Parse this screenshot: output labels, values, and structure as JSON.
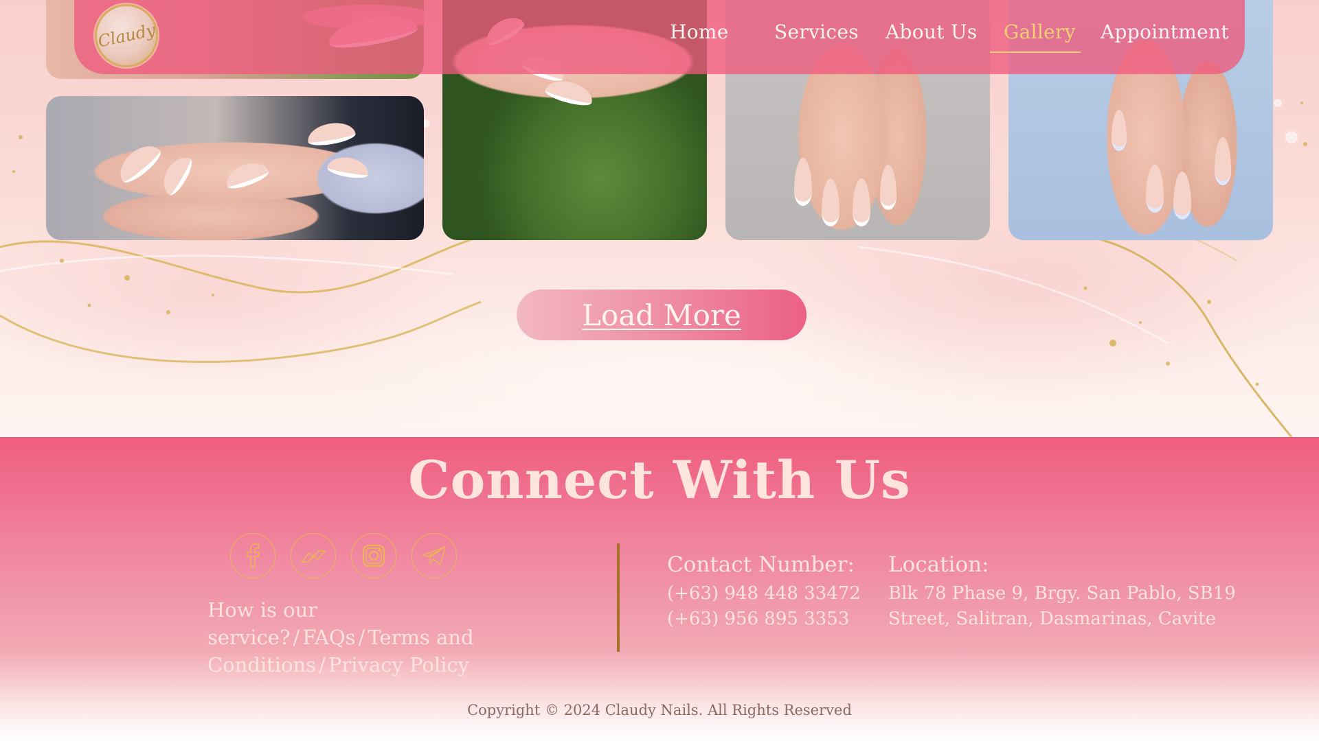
{
  "nav": {
    "logo_text": "Claudy",
    "items": [
      {
        "label": "Home"
      },
      {
        "label": "Services"
      },
      {
        "label": "About Us"
      },
      {
        "label": "Gallery"
      },
      {
        "label": "Appointment"
      }
    ],
    "active": "Gallery"
  },
  "gallery": {
    "load_more_label": "Load More"
  },
  "footer": {
    "title": "Connect With Us",
    "socials": [
      {
        "icon": "facebook-icon"
      },
      {
        "icon": "messenger-icon"
      },
      {
        "icon": "instagram-icon"
      },
      {
        "icon": "telegram-icon"
      }
    ],
    "links": {
      "service": "How is our service?",
      "faqs": "FAQs",
      "terms": "Terms and Conditions",
      "privacy": "Privacy Policy",
      "separator": "/"
    },
    "contact": {
      "heading": "Contact Number:",
      "phone_1": "(+63) 948 448 33472",
      "phone_2": "(+63) 956 895 3353"
    },
    "location": {
      "heading": "Location:",
      "line_1": "Blk 78 Phase 9, Brgy. San Pablo, SB19",
      "line_2": "Street, Salitran, Dasmarinas, Cavite"
    },
    "copyright": "Copyright © 2024 Claudy Nails. All Rights Reserved"
  },
  "colors": {
    "accent_pink": "#ee5a7e",
    "gold": "#e9b84f",
    "text_light": "#fde4dc"
  }
}
